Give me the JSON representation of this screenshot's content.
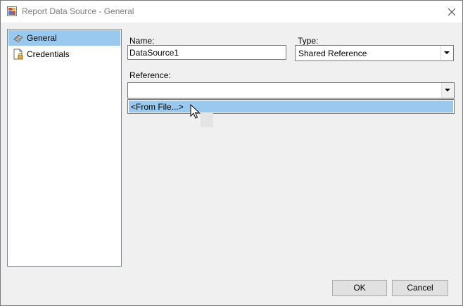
{
  "window": {
    "title": "Report Data Source - General"
  },
  "sidebar": {
    "items": [
      {
        "label": "General",
        "icon": "general-page-icon",
        "selected": true
      },
      {
        "label": "Credentials",
        "icon": "credentials-page-icon",
        "selected": false
      }
    ]
  },
  "form": {
    "name_label": "Name:",
    "name_value": "DataSource1",
    "type_label": "Type:",
    "type_value": "Shared Reference",
    "reference_label": "Reference:",
    "reference_value": "",
    "reference_options": [
      "<From File...>"
    ]
  },
  "buttons": {
    "ok": "OK",
    "cancel": "Cancel"
  },
  "colors": {
    "selection": "#99c9ef",
    "focus_border": "#3c7fb1"
  }
}
